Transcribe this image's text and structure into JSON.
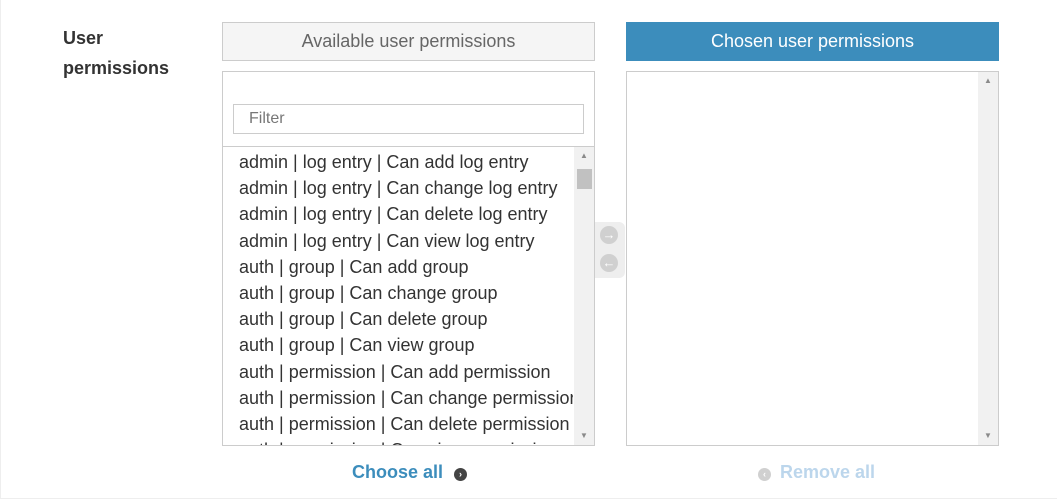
{
  "field": {
    "label": "User permissions"
  },
  "available": {
    "title": "Available user permissions",
    "filter_placeholder": "Filter",
    "filter_value": "",
    "options": [
      "admin | log entry | Can add log entry",
      "admin | log entry | Can change log entry",
      "admin | log entry | Can delete log entry",
      "admin | log entry | Can view log entry",
      "auth | group | Can add group",
      "auth | group | Can change group",
      "auth | group | Can delete group",
      "auth | group | Can view group",
      "auth | permission | Can add permission",
      "auth | permission | Can change permission",
      "auth | permission | Can delete permission",
      "auth | permission | Can view permission"
    ],
    "scroll_up_icon": "triangle-up",
    "scroll_down_icon": "triangle-down"
  },
  "chosen": {
    "title": "Chosen user permissions",
    "options": []
  },
  "actions": {
    "choose_all": "Choose all",
    "remove_all": "Remove all",
    "choose_icon": "arrow-right-circle-icon",
    "remove_icon": "arrow-left-circle-icon",
    "move_right_icon": "arrow-right-circle-icon",
    "move_left_icon": "arrow-left-circle-icon"
  },
  "colors": {
    "accent": "#3c8dbc",
    "accent_disabled": "#bcd6ec",
    "title_bg": "#f5f5f5",
    "border": "#cccccc",
    "text": "#333333"
  }
}
